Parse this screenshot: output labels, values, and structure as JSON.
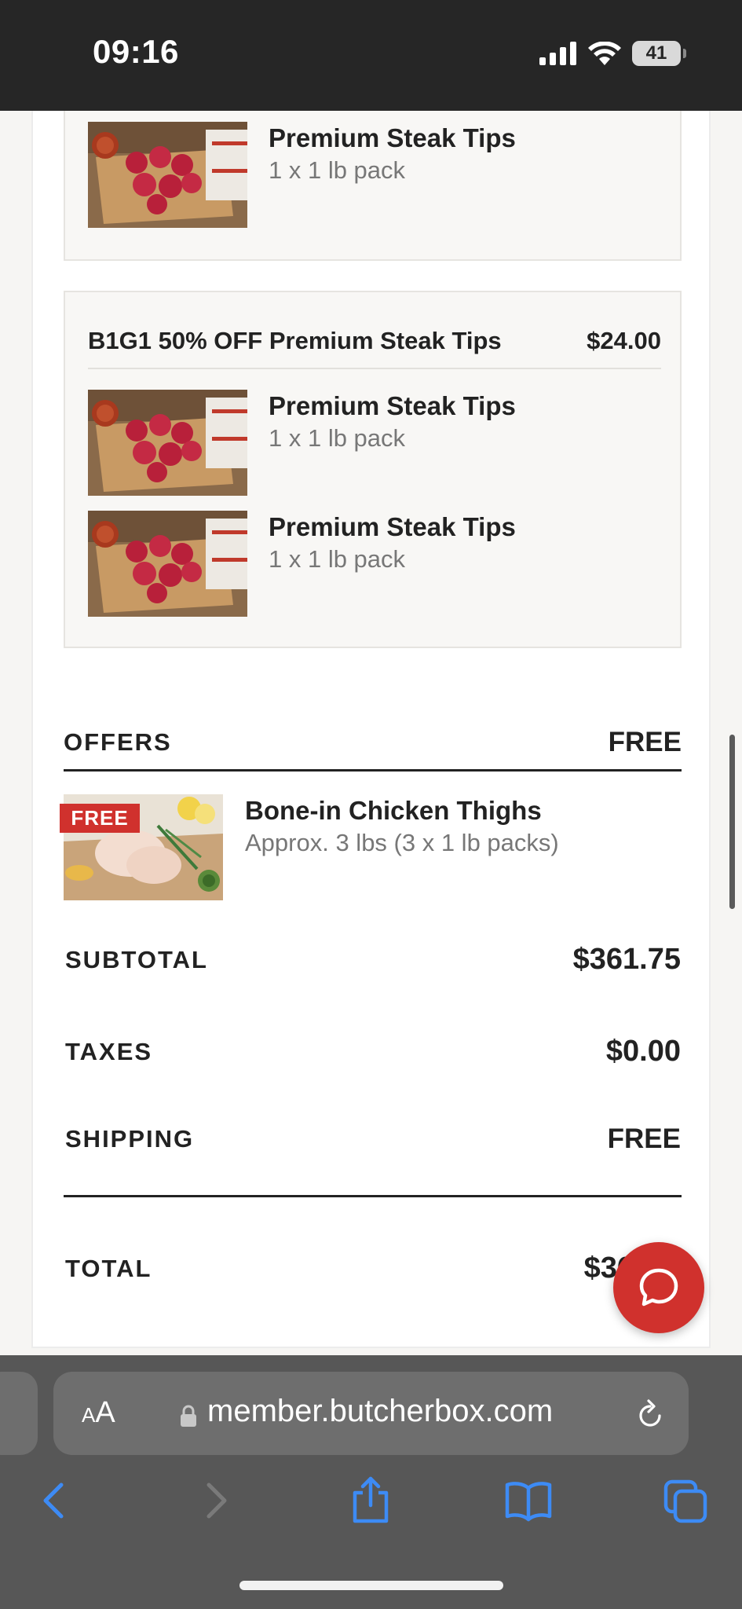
{
  "status": {
    "time": "09:16",
    "battery": "41"
  },
  "order": {
    "top_item": {
      "name": "Premium Steak Tips",
      "qty": "1 x 1 lb pack"
    },
    "bundle": {
      "title": "B1G1 50% OFF Premium Steak Tips",
      "price": "$24.00",
      "items": [
        {
          "name": "Premium Steak Tips",
          "qty": "1 x 1 lb pack"
        },
        {
          "name": "Premium Steak Tips",
          "qty": "1 x 1 lb pack"
        }
      ]
    }
  },
  "offers": {
    "label": "OFFERS",
    "value": "FREE",
    "item": {
      "badge": "FREE",
      "name": "Bone-in Chicken Thighs",
      "desc": "Approx. 3 lbs (3 x 1 lb packs)"
    }
  },
  "summary": {
    "subtotal_label": "SUBTOTAL",
    "subtotal_value": "$361.75",
    "taxes_label": "TAXES",
    "taxes_value": "$0.00",
    "shipping_label": "SHIPPING",
    "shipping_value": "FREE",
    "total_label": "TOTAL",
    "total_value": "$36"
  },
  "browser": {
    "aa_big": "A",
    "aa_small": "A",
    "url": "member.butcherbox.com"
  },
  "colors": {
    "accent": "#d0312d",
    "ios_blue": "#3d8bf5"
  }
}
